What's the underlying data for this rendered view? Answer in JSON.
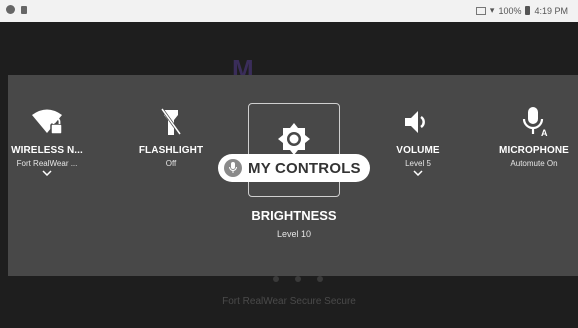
{
  "status_bar": {
    "battery": "100%",
    "time": "4:19 PM"
  },
  "background": {
    "footer_text": "Fort RealWear Secure Secure"
  },
  "controls": [
    {
      "label": "WIRELESS N...",
      "value": "Fort RealWear ...",
      "icon": "wifi-locked-icon",
      "has_chevron": true
    },
    {
      "label": "FLASHLIGHT",
      "value": "Off",
      "icon": "flashlight-off-icon",
      "has_chevron": false
    },
    {
      "label": "VOLUME",
      "value": "Level 5",
      "icon": "volume-icon",
      "has_chevron": true
    },
    {
      "label": "MICROPHONE",
      "value": "Automute On",
      "icon": "microphone-auto-icon",
      "has_chevron": false
    }
  ],
  "selected": {
    "label": "BRIGHTNESS",
    "value": "Level 10",
    "icon": "brightness-icon"
  },
  "pill": {
    "text": "MY CONTROLS",
    "icon": "microphone-icon"
  },
  "colors": {
    "panel": "#484848",
    "background": "#1e1e1e",
    "status_bar": "#f2f2f2"
  }
}
